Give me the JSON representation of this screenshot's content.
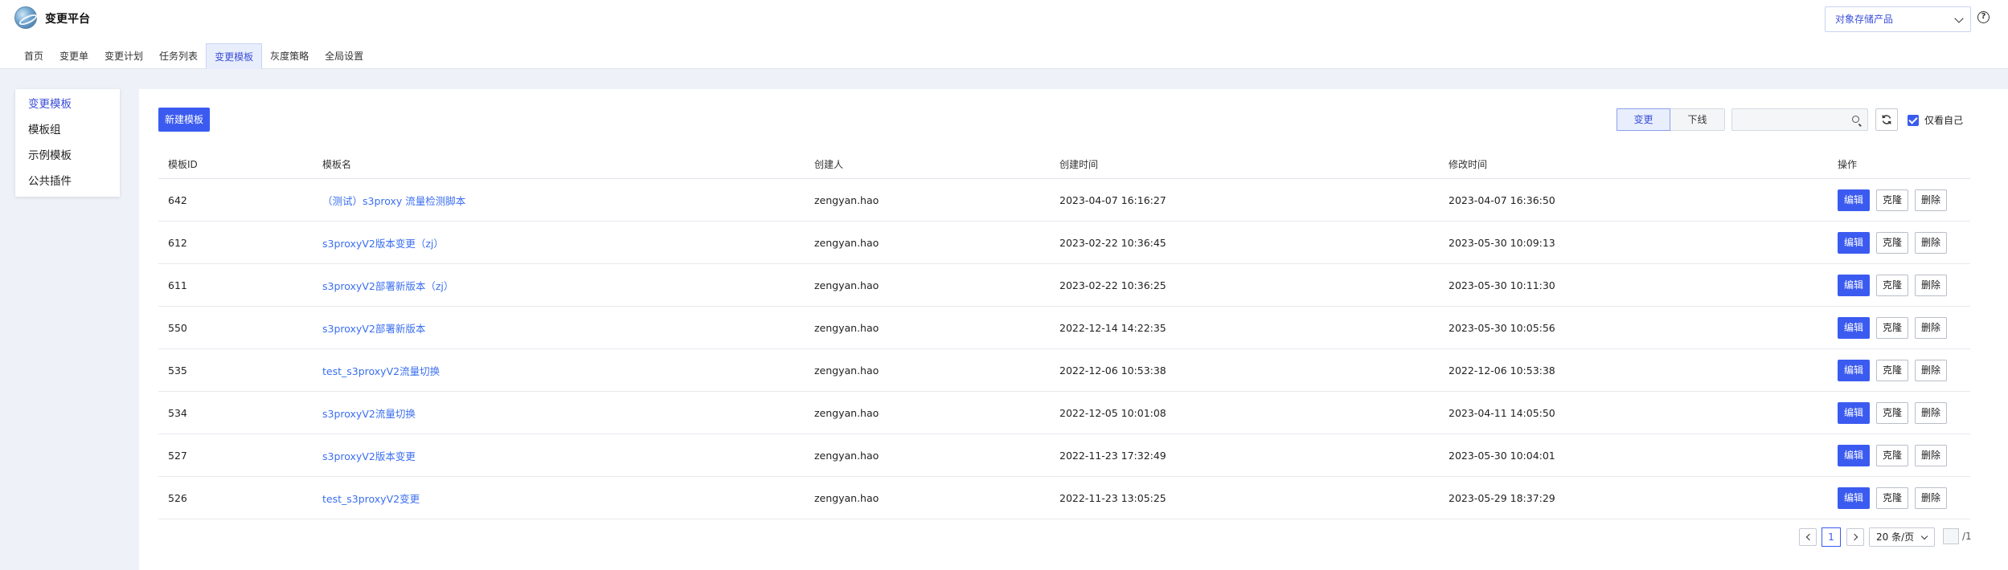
{
  "app": {
    "title": "变更平台"
  },
  "nav": [
    "首页",
    "变更单",
    "变更计划",
    "任务列表",
    "变更模板",
    "灰度策略",
    "全局设置"
  ],
  "nav_active_index": 4,
  "product_select": {
    "value": "对象存储产品"
  },
  "sidebar": {
    "items": [
      "变更模板",
      "模板组",
      "示例模板",
      "公共插件"
    ],
    "active_index": 0
  },
  "toolbar": {
    "new_button": "新建模板",
    "segments": [
      "变更",
      "下线"
    ],
    "segment_active_index": 0,
    "search_value": "",
    "only_mine_label": "仅看自己",
    "only_mine_checked": true
  },
  "table": {
    "columns": [
      "模板ID",
      "模板名",
      "创建人",
      "创建时间",
      "修改时间",
      "操作"
    ],
    "actions": [
      "编辑",
      "克隆",
      "删除"
    ],
    "rows": [
      {
        "id": "642",
        "name": "（测试）s3proxy 流量检测脚本",
        "creator": "zengyan.hao",
        "created": "2023-04-07 16:16:27",
        "modified": "2023-04-07 16:36:50"
      },
      {
        "id": "612",
        "name": "s3proxyV2版本变更（zj）",
        "creator": "zengyan.hao",
        "created": "2023-02-22 10:36:45",
        "modified": "2023-05-30 10:09:13"
      },
      {
        "id": "611",
        "name": "s3proxyV2部署新版本（zj）",
        "creator": "zengyan.hao",
        "created": "2023-02-22 10:36:25",
        "modified": "2023-05-30 10:11:30"
      },
      {
        "id": "550",
        "name": "s3proxyV2部署新版本",
        "creator": "zengyan.hao",
        "created": "2022-12-14 14:22:35",
        "modified": "2023-05-30 10:05:56"
      },
      {
        "id": "535",
        "name": "test_s3proxyV2流量切换",
        "creator": "zengyan.hao",
        "created": "2022-12-06 10:53:38",
        "modified": "2022-12-06 10:53:38"
      },
      {
        "id": "534",
        "name": "s3proxyV2流量切换",
        "creator": "zengyan.hao",
        "created": "2022-12-05 10:01:08",
        "modified": "2023-04-11 14:05:50"
      },
      {
        "id": "527",
        "name": "s3proxyV2版本变更",
        "creator": "zengyan.hao",
        "created": "2022-11-23 17:32:49",
        "modified": "2023-05-30 10:04:01"
      },
      {
        "id": "526",
        "name": "test_s3proxyV2变更",
        "creator": "zengyan.hao",
        "created": "2022-11-23 13:05:25",
        "modified": "2023-05-29 18:37:29"
      }
    ]
  },
  "pagination": {
    "current_page": "1",
    "page_size": "20 条/页",
    "total_pages": "/1"
  },
  "colors": {
    "primary": "#3b5bf0",
    "link": "#3b6ff0",
    "background": "#eef2f8"
  }
}
